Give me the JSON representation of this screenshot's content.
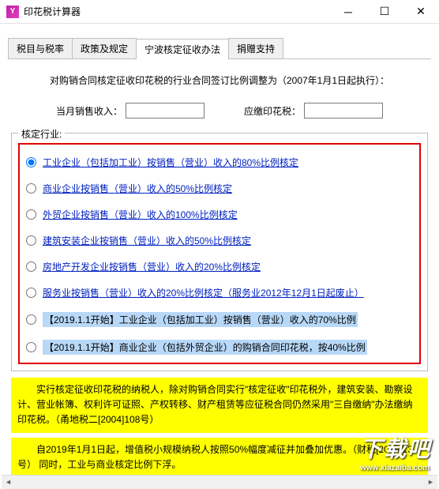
{
  "window": {
    "icon_letter": "Y",
    "title": "印花税计算器"
  },
  "tabs": [
    {
      "label": "税目与税率",
      "active": false
    },
    {
      "label": "政策及规定",
      "active": false
    },
    {
      "label": "宁波核定征收办法",
      "active": true
    },
    {
      "label": "捐赠支持",
      "active": false
    }
  ],
  "intro": "对购销合同核定征收印花税的行业合同签订比例调整为（2007年1月1日起执行）：",
  "inputs": {
    "sales_label": "当月销售收入：",
    "sales_value": "",
    "tax_label": "应缴印花税：",
    "tax_value": ""
  },
  "fieldset_legend": "核定行业:",
  "radios": [
    {
      "text": "工业企业（包括加工业）按销售（营业）收入的80%比例核定",
      "checked": true,
      "highlight": false
    },
    {
      "text": "商业企业按销售（营业）收入的50%比例核定",
      "checked": false,
      "highlight": false
    },
    {
      "text": "外贸企业按销售（营业）收入的100%比例核定",
      "checked": false,
      "highlight": false
    },
    {
      "text": "建筑安装企业按销售（营业）收入的50%比例核定",
      "checked": false,
      "highlight": false
    },
    {
      "text": "房地产开发企业按销售（营业）收入的20%比例核定",
      "checked": false,
      "highlight": false
    },
    {
      "text": "服务业按销售（营业）收入的20%比例核定（服务业2012年12月1日起废止）",
      "checked": false,
      "highlight": false
    },
    {
      "text": "【2019.1.1开始】工业企业（包括加工业）按销售（营业）收入的70%比例",
      "checked": false,
      "highlight": true
    },
    {
      "text": "【2019.1.1开始】商业企业（包括外贸企业）的购销合同印花税，按40%比例",
      "checked": false,
      "highlight": true
    }
  ],
  "notes": [
    "实行核定征收印花税的纳税人，除对购销合同实行\"核定征收\"印花税外，建筑安装、勘察设计、营业帐簿、权利许可证照、产权转移、财产租赁等应征税合同仍然采用\"三自缴纳\"办法缴纳印花税。（甬地税二[2004]108号）",
    "自2019年1月1日起，增值税小规模纳税人按照50%幅度减征并加叠加优惠。（财税[2019]13号）\n同时，工业与商业核定比例下浮。"
  ],
  "watermark": {
    "brand": "下载吧",
    "url": "www.xiazaiba.com"
  }
}
